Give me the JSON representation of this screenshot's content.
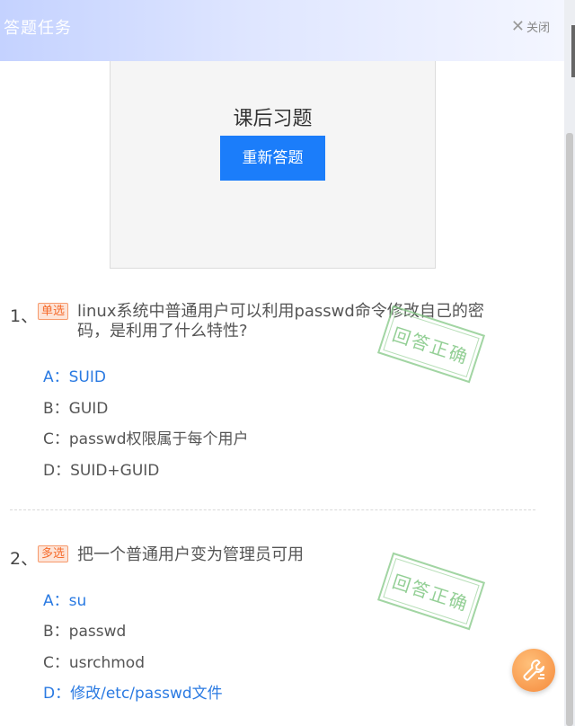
{
  "header": {
    "title": "答题任务",
    "close_label": "关闭"
  },
  "card": {
    "title": "课后习题",
    "redo_label": "重新答题"
  },
  "questions": [
    {
      "number": "1、",
      "tag": "单选",
      "text_line1": "linux系统中普通用户可以利用passwd命令修改自己的密",
      "text_line2": "码，是利用了什么特性?",
      "stamp": "回答正确",
      "options": [
        {
          "label": "A：SUID",
          "selected": true
        },
        {
          "label": "B：GUID",
          "selected": false
        },
        {
          "label": "C：passwd权限属于每个用户",
          "selected": false
        },
        {
          "label": "D：SUID+GUID",
          "selected": false
        }
      ]
    },
    {
      "number": "2、",
      "tag": "多选",
      "text_line1": "把一个普通用户变为管理员可用",
      "stamp": "回答正确",
      "options": [
        {
          "label": "A：su",
          "selected": true
        },
        {
          "label": "B：passwd",
          "selected": false
        },
        {
          "label": "C：usrchmod",
          "selected": false
        },
        {
          "label": "D：修改/etc/passwd文件",
          "selected": true
        }
      ]
    }
  ],
  "icons": {
    "close": "close-icon",
    "tool": "wrench-icon"
  },
  "colors": {
    "accent": "#1b7dfa",
    "selected_option": "#2a7ae2",
    "tag": "#f56a2a",
    "stamp": "#6fbf72"
  }
}
